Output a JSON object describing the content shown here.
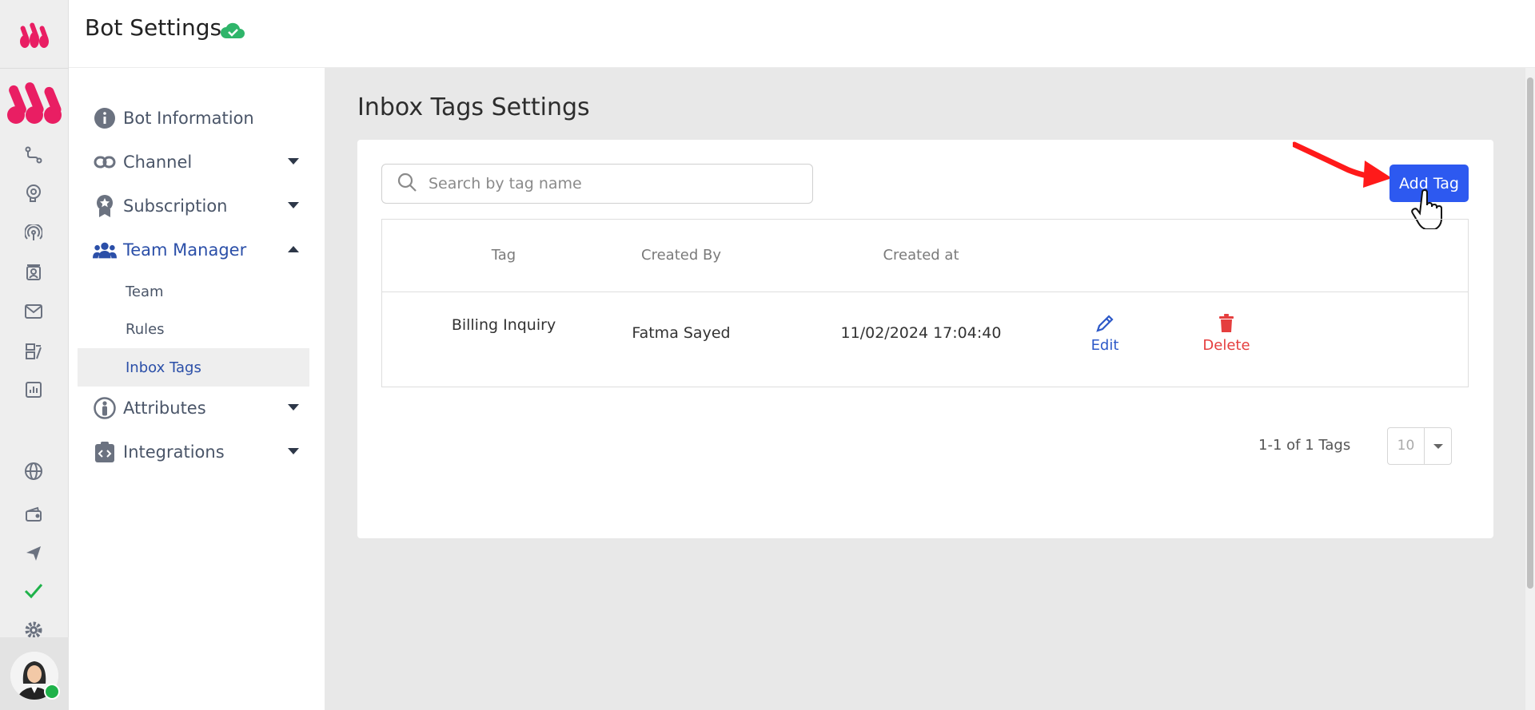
{
  "header": {
    "title": "Bot Settings"
  },
  "colors": {
    "accent": "#2d59f0",
    "brand": "#e91e63",
    "danger": "#e53e3e",
    "link": "#2b4fa8",
    "online": "#1fb24a"
  },
  "rail": {
    "icons": [
      "flow-icon",
      "bot-brain-icon",
      "broadcast-icon",
      "contacts-icon",
      "mail-icon",
      "dashboard-icon",
      "analytics-icon",
      "globe-icon",
      "wallet-icon",
      "send-icon",
      "check-icon",
      "gear-icon"
    ]
  },
  "sidebar": {
    "items": [
      {
        "label": "Bot Information",
        "icon": "info-icon"
      },
      {
        "label": "Channel",
        "icon": "link-icon"
      },
      {
        "label": "Subscription",
        "icon": "badge-icon"
      },
      {
        "label": "Team Manager",
        "icon": "team-icon"
      },
      {
        "label": "Attributes",
        "icon": "person-icon"
      },
      {
        "label": "Integrations",
        "icon": "code-icon"
      }
    ],
    "sub_items": [
      "Team",
      "Rules",
      "Inbox Tags"
    ]
  },
  "main": {
    "page_title": "Inbox Tags Settings",
    "search_placeholder": "Search by tag name",
    "add_button": "Add Tag",
    "table": {
      "headers": [
        "Tag",
        "Created By",
        "Created at"
      ],
      "rows": [
        {
          "tag": "Billing Inquiry",
          "created_by": "Fatma Sayed",
          "created_at": "11/02/2024 17:04:40",
          "edit": "Edit",
          "delete": "Delete"
        }
      ]
    },
    "pagination": {
      "summary": "1-1 of 1 Tags",
      "page_size": "10"
    }
  }
}
